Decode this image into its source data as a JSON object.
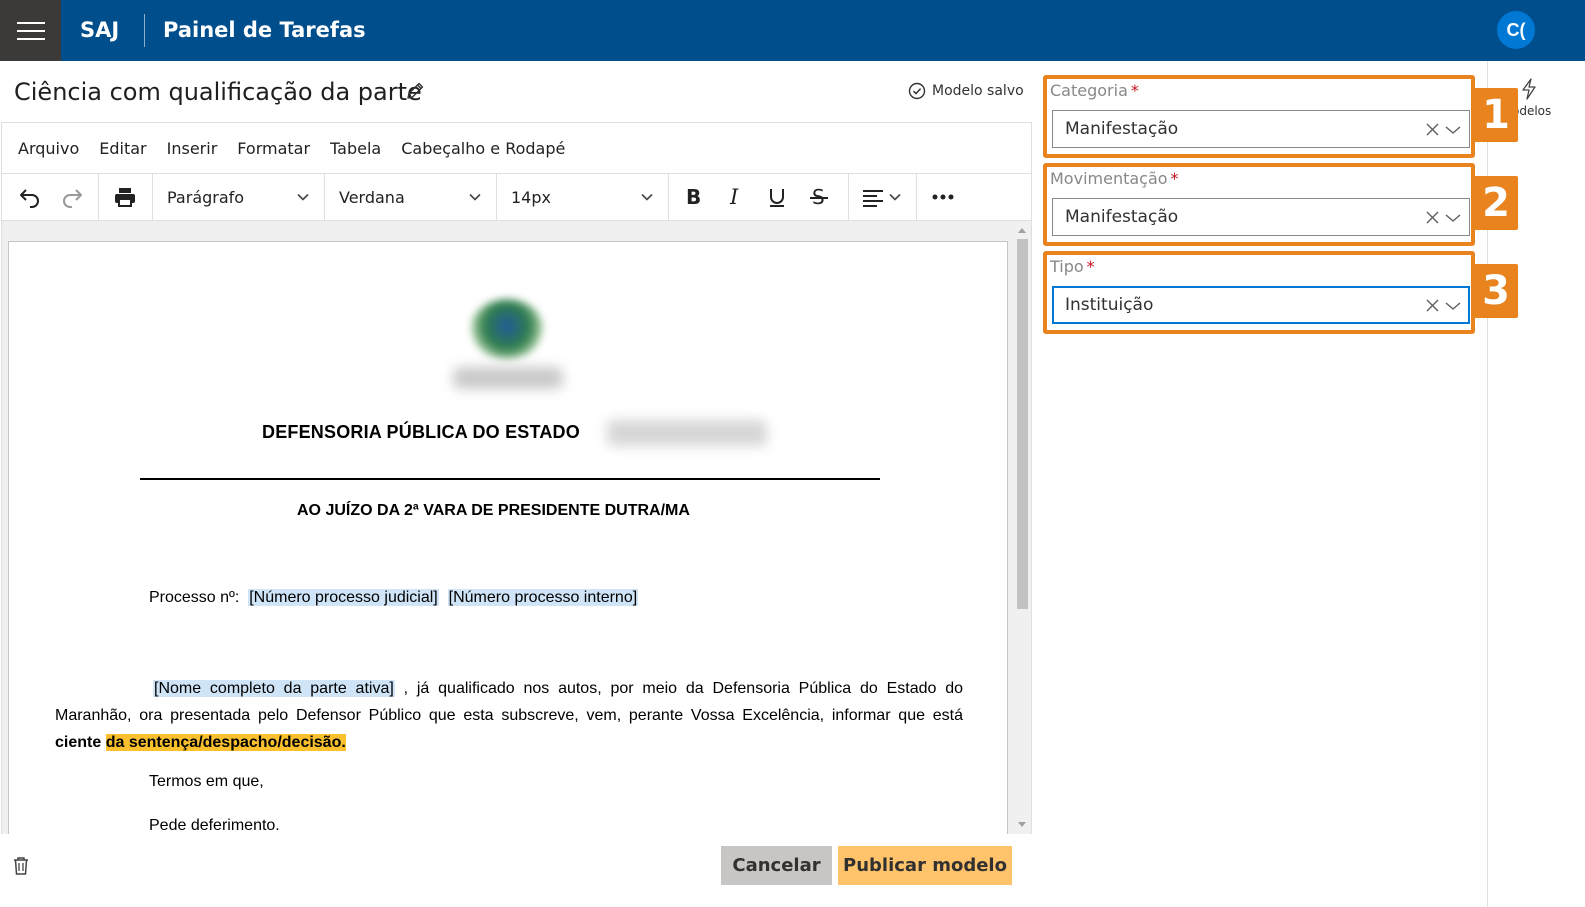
{
  "topbar": {
    "app_name": "SAJ",
    "page_name": "Painel de Tarefas",
    "avatar_initials": "C("
  },
  "document": {
    "title": "Ciência com qualificação da parte",
    "status": "Modelo salvo"
  },
  "menubar": [
    "Arquivo",
    "Editar",
    "Inserir",
    "Formatar",
    "Tabela",
    "Cabeçalho e Rodapé"
  ],
  "toolbar": {
    "block_format": "Parágrafo",
    "font_family": "Verdana",
    "font_size": "14px"
  },
  "content": {
    "heading1": "DEFENSORIA PÚBLICA DO ESTADO",
    "heading2": "AO JUÍZO DA 2ª VARA DE PRESIDENTE DUTRA/MA",
    "processo_label": "Processo nº:",
    "tag_processo_judicial": "[Número processo judicial]",
    "tag_processo_interno": "[Número processo interno]",
    "tag_nome_parte": "[Nome completo da parte ativa]",
    "paragraph_text": " , já qualificado nos autos, por meio da Defensoria Pública do Estado do Maranhão, ora presentada pelo Defensor Público que esta subscreve, vem, perante Vossa Excelência, informar que está ",
    "paragraph_bold": "ciente",
    "paragraph_highlight": "da sentença/despacho/decisão",
    "paragraph_end": ".",
    "closing1": "Termos em que,",
    "closing2": "Pede deferimento."
  },
  "footer": {
    "cancel_label": "Cancelar",
    "publish_label": "Publicar modelo"
  },
  "panel": {
    "modelos_label": "odelos",
    "fields": [
      {
        "badge": "1",
        "label": "Categoria",
        "required_mark": "*",
        "value": "Manifestação"
      },
      {
        "badge": "2",
        "label": "Movimentação",
        "required_mark": "*",
        "value": "Manifestação"
      },
      {
        "badge": "3",
        "label": "Tipo",
        "required_mark": "*",
        "value": "Instituição"
      }
    ]
  },
  "colors": {
    "topbar": "#004e8c",
    "hamburger_bg": "#3b3a39",
    "avatar": "#0078d4",
    "annotation": "#e8831e",
    "highlight": "#fbc02d",
    "tag": "#cfe4f7",
    "publish_button": "#ffc46b",
    "cancel_button": "#c8c6c4"
  },
  "icons": [
    "hamburger-icon",
    "pencil-icon",
    "check-circle-icon",
    "undo-icon",
    "redo-icon",
    "print-icon",
    "bold-icon",
    "italic-icon",
    "underline-icon",
    "strikethrough-icon",
    "align-left-icon",
    "more-icon",
    "trash-icon",
    "lightning-icon",
    "clear-icon",
    "chevron-down-icon"
  ]
}
